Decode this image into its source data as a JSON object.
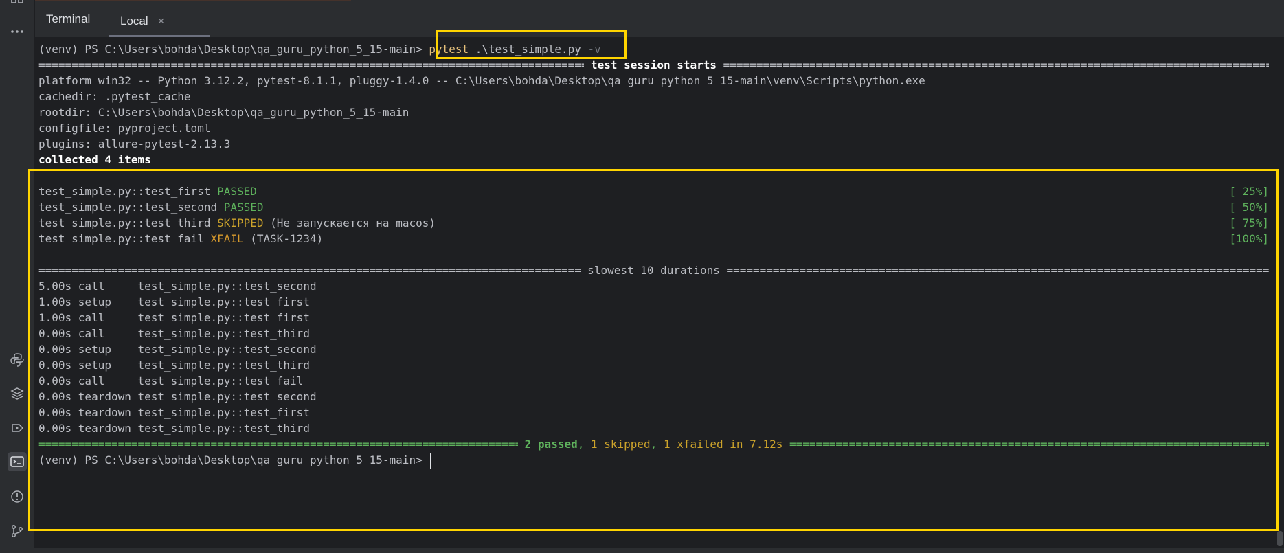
{
  "sidebar": {
    "icons": [
      "apps-icon",
      "more-icon",
      "python-icon",
      "layers-icon",
      "services-icon",
      "terminal-icon",
      "problems-icon",
      "git-icon"
    ]
  },
  "tabs": {
    "title": "Terminal",
    "local_label": "Local",
    "close_glyph": "×"
  },
  "terminal": {
    "prompt": "(venv) PS C:\\Users\\bohda\\Desktop\\qa_guru_python_5_15-main>",
    "command_word": "pytest",
    "command_arg": ".\\test_simple.py",
    "command_flag": "-v",
    "session_header": " test session starts ",
    "platform": "platform win32 -- Python 3.12.2, pytest-8.1.1, pluggy-1.4.0 -- C:\\Users\\bohda\\Desktop\\qa_guru_python_5_15-main\\venv\\Scripts\\python.exe",
    "cachedir": "cachedir: .pytest_cache",
    "rootdir": "rootdir: C:\\Users\\bohda\\Desktop\\qa_guru_python_5_15-main",
    "configfile": "configfile: pyproject.toml",
    "plugins": "plugins: allure-pytest-2.13.3",
    "collected": "collected 4 items",
    "results": [
      {
        "name": "test_simple.py::test_first ",
        "status": "PASSED",
        "note": "",
        "pct": "[ 25%]"
      },
      {
        "name": "test_simple.py::test_second ",
        "status": "PASSED",
        "note": "",
        "pct": "[ 50%]"
      },
      {
        "name": "test_simple.py::test_third ",
        "status": "SKIPPED",
        "note": " (Не запускается на macos)",
        "pct": "[ 75%]"
      },
      {
        "name": "test_simple.py::test_fail ",
        "status": "XFAIL",
        "note": " (TASK-1234)",
        "pct": "[100%]"
      }
    ],
    "durations_header": " slowest 10 durations ",
    "durations": [
      "5.00s call     test_simple.py::test_second",
      "1.00s setup    test_simple.py::test_first",
      "1.00s call     test_simple.py::test_first",
      "0.00s call     test_simple.py::test_third",
      "0.00s setup    test_simple.py::test_second",
      "0.00s setup    test_simple.py::test_third",
      "0.00s call     test_simple.py::test_fail",
      "0.00s teardown test_simple.py::test_second",
      "0.00s teardown test_simple.py::test_first",
      "0.00s teardown test_simple.py::test_third"
    ],
    "summary": {
      "passed": "2 passed",
      "comma1": ", ",
      "skipped": "1 skipped",
      "comma2": ", ",
      "xfailed": "1 xfailed in 7.12s"
    },
    "final_prompt": "(venv) PS C:\\Users\\bohda\\Desktop\\qa_guru_python_5_15-main>"
  },
  "colors": {
    "highlight": "#ffd400",
    "passed": "#5fb35d",
    "skipped": "#cca32b",
    "background": "#1e1f22"
  }
}
